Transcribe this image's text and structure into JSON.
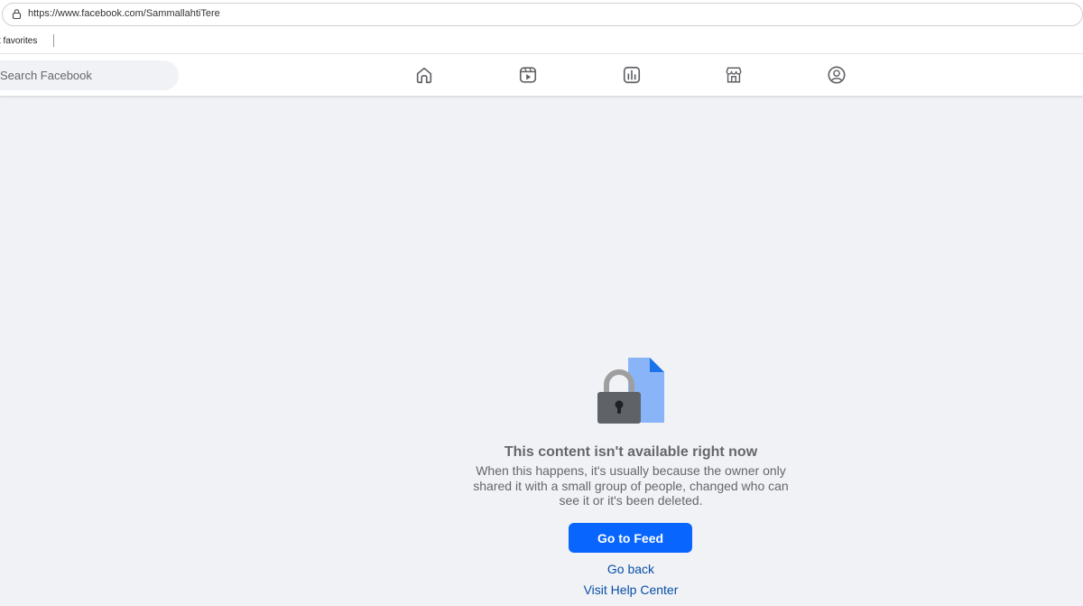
{
  "browser": {
    "url": "https://www.facebook.com/SammallahtiTere",
    "favorites_label": "t favorites"
  },
  "nav": {
    "search_placeholder": "Search Facebook",
    "icons": [
      "home-icon",
      "video-icon",
      "groups-stats-icon",
      "marketplace-icon",
      "profile-icon"
    ]
  },
  "content": {
    "title": "This content isn't available right now",
    "body": "When this happens, it's usually because the owner only shared it with a small group of people, changed who can see it or it's been deleted.",
    "primary_button": "Go to Feed",
    "go_back": "Go back",
    "help_center": "Visit Help Center"
  },
  "colors": {
    "accent": "#0866ff",
    "link": "#0a4fa8",
    "text_secondary": "#65676b",
    "background": "#f0f2f5"
  }
}
